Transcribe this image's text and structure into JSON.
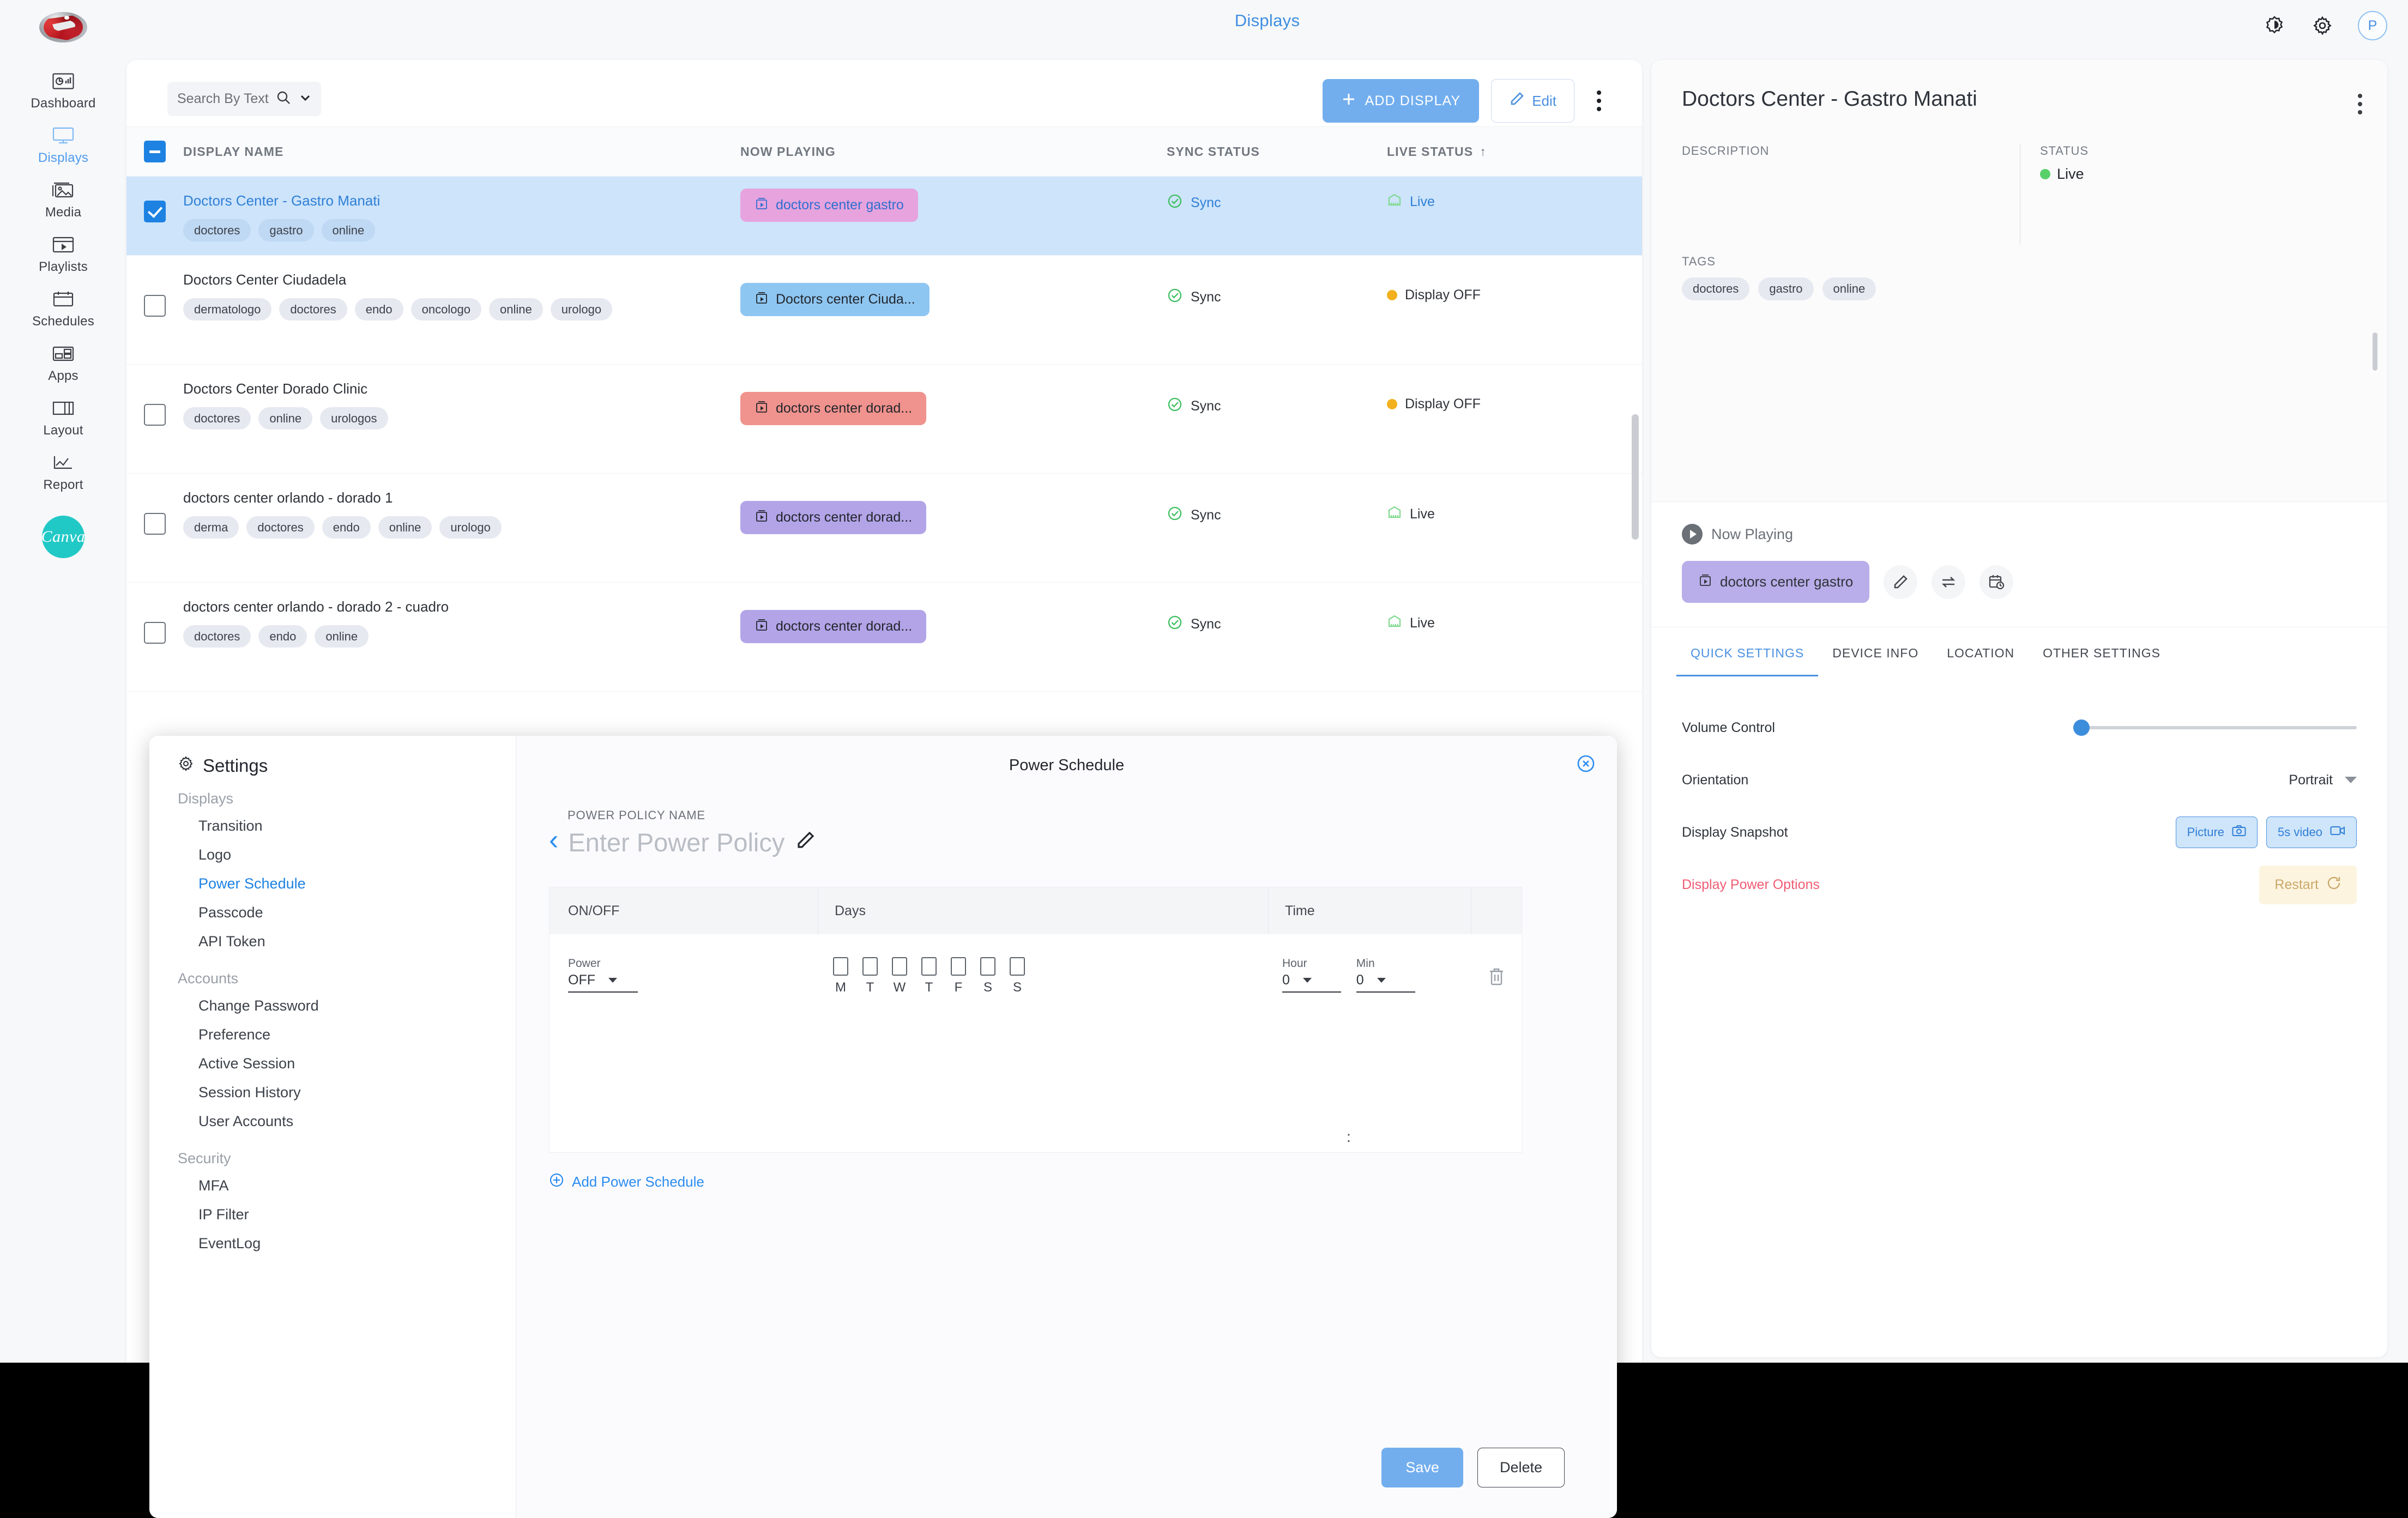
{
  "header": {
    "page_title": "Displays",
    "brightness_icon": "brightness-icon",
    "settings_icon": "gear-icon",
    "avatar_initial": "P"
  },
  "sidebar": {
    "logo_name": "app-logo",
    "items": [
      {
        "label": "Dashboard",
        "icon": "dashboard-icon",
        "active": false
      },
      {
        "label": "Displays",
        "icon": "monitor-icon",
        "active": true
      },
      {
        "label": "Media",
        "icon": "image-icon",
        "active": false
      },
      {
        "label": "Playlists",
        "icon": "playlist-icon",
        "active": false
      },
      {
        "label": "Schedules",
        "icon": "calendar-icon",
        "active": false
      },
      {
        "label": "Apps",
        "icon": "apps-icon",
        "active": false
      },
      {
        "label": "Layout",
        "icon": "layout-icon",
        "active": false
      },
      {
        "label": "Report",
        "icon": "chart-icon",
        "active": false
      }
    ],
    "canva_label": "Canva"
  },
  "toolbar": {
    "search_placeholder": "Search By Text",
    "add_display_label": "ADD DISPLAY",
    "edit_label": "Edit",
    "more_icon": "kebab-menu-icon"
  },
  "table": {
    "columns": [
      "DISPLAY NAME",
      "NOW PLAYING",
      "SYNC STATUS",
      "LIVE STATUS"
    ],
    "sort_indicator": "↑",
    "rows": [
      {
        "name": "Doctors Center - Gastro Manati",
        "tags": [
          "doctores",
          "gastro",
          "online"
        ],
        "now_playing": "doctors center gastro",
        "chip_color": "pink",
        "sync_status": "Sync",
        "live_status": "Live",
        "live_state": "live",
        "selected": true
      },
      {
        "name": "Doctors Center Ciudadela",
        "tags": [
          "dermatologo",
          "doctores",
          "endo",
          "oncologo",
          "online",
          "urologo"
        ],
        "now_playing": "Doctors center Ciuda...",
        "chip_color": "blue",
        "sync_status": "Sync",
        "live_status": "Display OFF",
        "live_state": "off",
        "selected": false
      },
      {
        "name": "Doctors Center Dorado Clinic",
        "tags": [
          "doctores",
          "online",
          "urologos"
        ],
        "now_playing": "doctors center dorad...",
        "chip_color": "red",
        "sync_status": "Sync",
        "live_status": "Display OFF",
        "live_state": "off",
        "selected": false
      },
      {
        "name": "doctors center orlando - dorado 1",
        "tags": [
          "derma",
          "doctores",
          "endo",
          "online",
          "urologo"
        ],
        "now_playing": "doctors center dorad...",
        "chip_color": "purple",
        "sync_status": "Sync",
        "live_status": "Live",
        "live_state": "live",
        "selected": false
      },
      {
        "name": "doctors center orlando - dorado 2 - cuadro",
        "tags": [
          "doctores",
          "endo",
          "online"
        ],
        "now_playing": "doctors center dorad...",
        "chip_color": "purple",
        "sync_status": "Sync",
        "live_status": "Live",
        "live_state": "live",
        "selected": false
      }
    ]
  },
  "details": {
    "title": "Doctors Center - Gastro Manati",
    "description_label": "DESCRIPTION",
    "description_value": "",
    "status_label": "STATUS",
    "status_value": "Live",
    "tags_label": "TAGS",
    "tags": [
      "doctores",
      "gastro",
      "online"
    ],
    "now_playing_label": "Now Playing",
    "now_playing_item": "doctors center gastro",
    "action_icons": [
      "edit-pencil-icon",
      "swap-icon",
      "schedule-clock-icon"
    ],
    "tabs": [
      {
        "label": "QUICK SETTINGS",
        "active": true
      },
      {
        "label": "DEVICE INFO",
        "active": false
      },
      {
        "label": "LOCATION",
        "active": false
      },
      {
        "label": "OTHER SETTINGS",
        "active": false
      }
    ],
    "quick_settings": {
      "volume_label": "Volume Control",
      "volume_value": 0,
      "orientation_label": "Orientation",
      "orientation_value": "Portrait",
      "snapshot_label": "Display Snapshot",
      "snapshot_picture": "Picture",
      "snapshot_video": "5s video",
      "power_options_label": "Display Power Options",
      "restart_label": "Restart"
    }
  },
  "settings_modal": {
    "side_title": "Settings",
    "groups": [
      {
        "name": "Displays",
        "items": [
          {
            "label": "Transition",
            "active": false
          },
          {
            "label": "Logo",
            "active": false
          },
          {
            "label": "Power Schedule",
            "active": true
          },
          {
            "label": "Passcode",
            "active": false
          },
          {
            "label": "API Token",
            "active": false
          }
        ]
      },
      {
        "name": "Accounts",
        "items": [
          {
            "label": "Change Password",
            "active": false
          },
          {
            "label": "Preference",
            "active": false
          },
          {
            "label": "Active Session",
            "active": false
          },
          {
            "label": "Session History",
            "active": false
          },
          {
            "label": "User Accounts",
            "active": false
          }
        ]
      },
      {
        "name": "Security",
        "items": [
          {
            "label": "MFA",
            "active": false
          },
          {
            "label": "IP Filter",
            "active": false
          },
          {
            "label": "EventLog",
            "active": false
          }
        ]
      }
    ],
    "main": {
      "title": "Power Schedule",
      "policy_label": "POWER POLICY NAME",
      "policy_placeholder": "Enter Power Policy",
      "back_icon": "chevron-left-icon",
      "edit_icon": "edit-pencil-icon",
      "close_icon": "close-icon",
      "table_headers": [
        "ON/OFF",
        "Days",
        "Time"
      ],
      "power_label": "Power",
      "power_value": "OFF",
      "day_labels": [
        "M",
        "T",
        "W",
        "T",
        "F",
        "S",
        "S"
      ],
      "hour_label": "Hour",
      "min_label": "Min",
      "hour_value": "0",
      "min_value": "0",
      "delete_row_icon": "trash-icon",
      "add_schedule_label": "Add Power Schedule",
      "save_label": "Save",
      "delete_label": "Delete"
    }
  },
  "colors": {
    "accent_blue": "#4a90e2",
    "selected_row": "#cde4fb",
    "status_green": "#58d06a",
    "status_amber": "#f2b01e",
    "danger_red": "#ef5b72"
  }
}
